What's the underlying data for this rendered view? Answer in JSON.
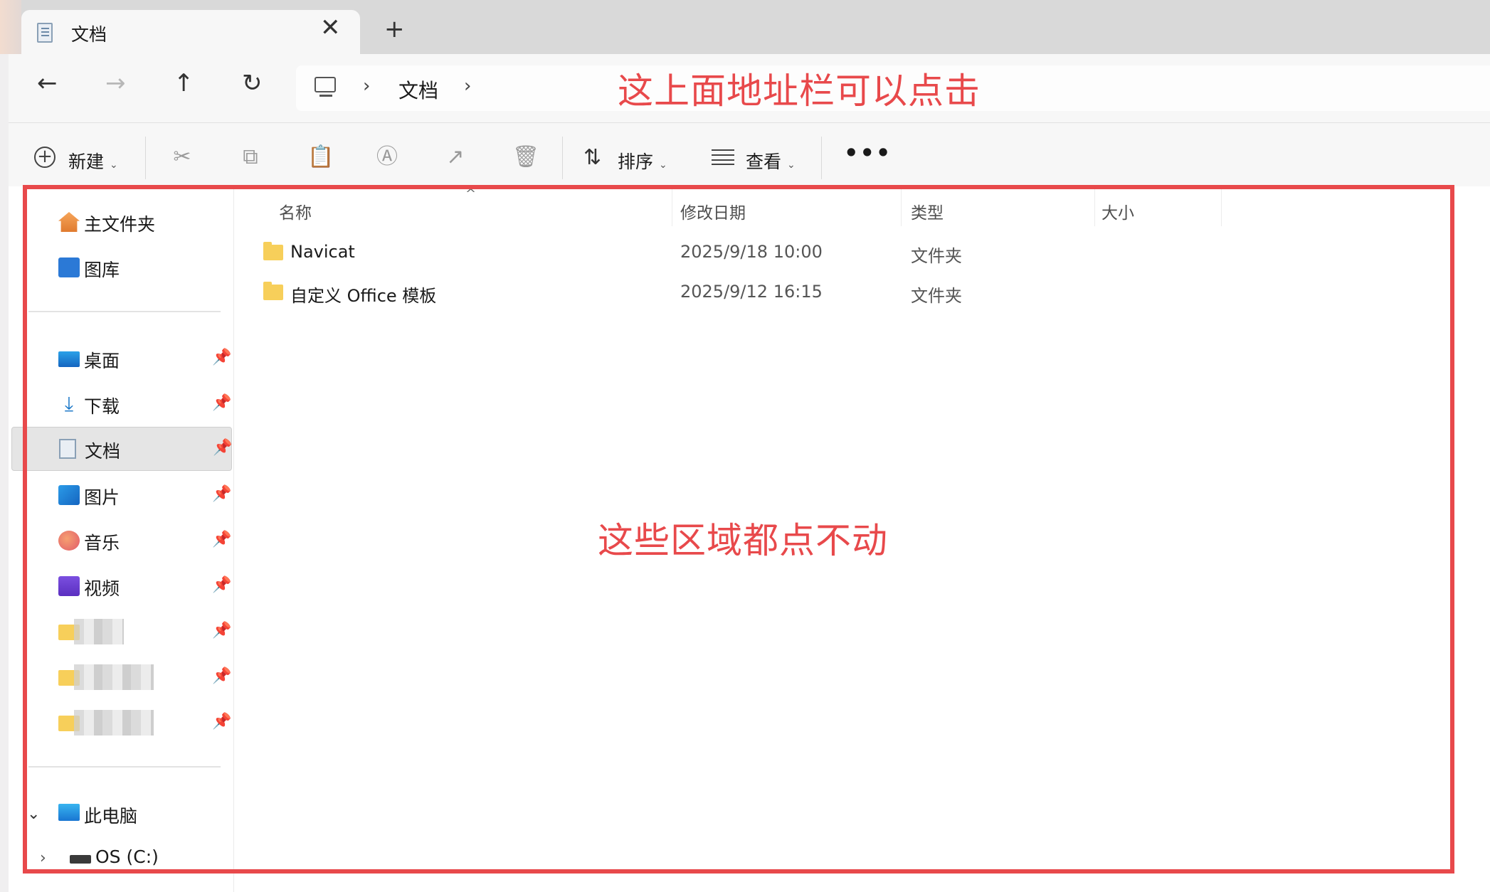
{
  "tab": {
    "title": "文档",
    "close_glyph": "✕",
    "new_glyph": "+"
  },
  "nav": {
    "back_glyph": "←",
    "forward_glyph": "→",
    "up_glyph": "↑",
    "refresh_glyph": "↻",
    "address_segments": [
      "文档"
    ],
    "chevron": "›"
  },
  "toolbar": {
    "new_label": "新建",
    "sort_label": "排序",
    "view_label": "查看",
    "caret": "⌄",
    "more_glyph": "•••",
    "icons": [
      "cut-icon",
      "copy-icon",
      "paste-icon",
      "rename-icon",
      "share-icon",
      "delete-icon"
    ]
  },
  "sidebar": {
    "quick": [
      {
        "label": "主文件夹",
        "icon": "home-icon"
      },
      {
        "label": "图库",
        "icon": "gallery-icon"
      }
    ],
    "pinned": [
      {
        "label": "桌面",
        "icon": "desktop-icon"
      },
      {
        "label": "下载",
        "icon": "download-icon"
      },
      {
        "label": "文档",
        "icon": "documents-icon",
        "selected": true
      },
      {
        "label": "图片",
        "icon": "pictures-icon"
      },
      {
        "label": "音乐",
        "icon": "music-icon"
      },
      {
        "label": "视频",
        "icon": "videos-icon"
      }
    ],
    "pin_glyph": "📌",
    "this_pc": "此电脑",
    "drive_c": "OS (C:)",
    "expanded_glyph": "⌄",
    "collapsed_glyph": "›"
  },
  "files": {
    "columns": {
      "name": "名称",
      "date": "修改日期",
      "type": "类型",
      "size": "大小"
    },
    "sort_glyph": "^",
    "rows": [
      {
        "name": "Navicat",
        "date": "2025/9/18 10:00",
        "type": "文件夹",
        "size": ""
      },
      {
        "name": "自定义 Office 模板",
        "date": "2025/9/12 16:15",
        "type": "文件夹",
        "size": ""
      }
    ]
  },
  "annotations": {
    "top_note": "这上面地址栏可以点击",
    "middle_note": "这些区域都点不动",
    "color": "#e8494b"
  }
}
